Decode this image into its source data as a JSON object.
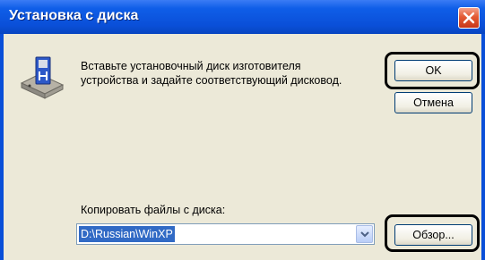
{
  "window": {
    "title": "Установка с диска"
  },
  "message": {
    "line1": "Вставьте установочный диск изготовителя",
    "line2": "устройства и задайте соответствующий дисковод."
  },
  "buttons": {
    "ok": "OK",
    "cancel": "Отмена",
    "browse": "Обзор..."
  },
  "copy_from": {
    "label": "Копировать файлы с диска:",
    "value": "D:\\Russian\\WinXP"
  },
  "icons": {
    "close": "close-icon",
    "disk": "install-disk-icon",
    "dropdown": "chevron-down-icon"
  },
  "colors": {
    "titlebar": "#0a4fd8",
    "close": "#e35a34",
    "selection": "#316ac5",
    "face": "#ece9d8"
  }
}
